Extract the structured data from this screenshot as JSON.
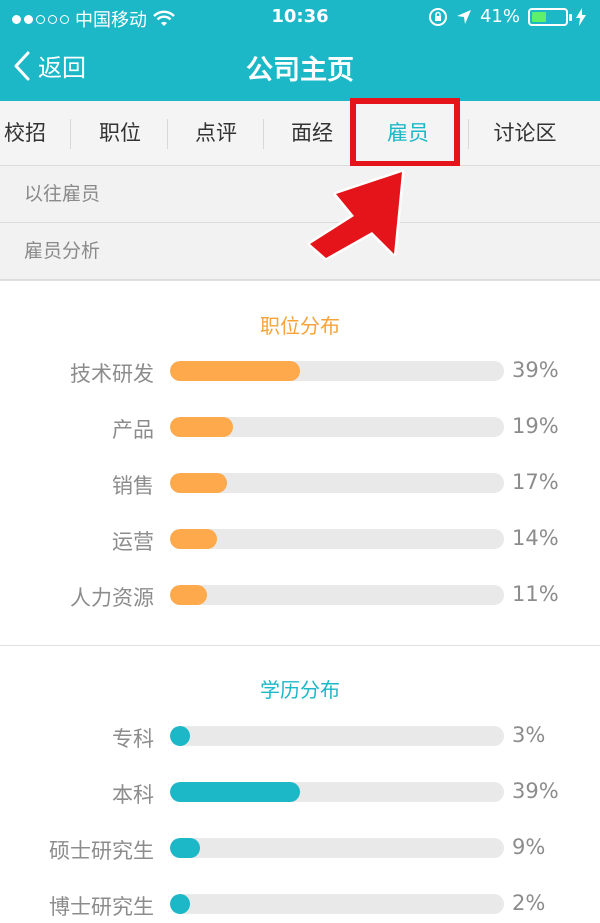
{
  "status_bar": {
    "carrier": "中国移动",
    "time": "10:36",
    "battery": "41%",
    "battery_level": 0.41
  },
  "nav": {
    "back_label": "返回",
    "title": "公司主页"
  },
  "tabs": [
    {
      "label": "校招",
      "active": false
    },
    {
      "label": "职位",
      "active": false
    },
    {
      "label": "点评",
      "active": false
    },
    {
      "label": "面经",
      "active": false
    },
    {
      "label": "雇员",
      "active": true
    },
    {
      "label": "讨论区",
      "active": false
    }
  ],
  "submenu": [
    {
      "label": "以往雇员"
    },
    {
      "label": "雇员分析"
    }
  ],
  "colors": {
    "accent": "#1db8c8",
    "orange": "#ffa94d",
    "highlight": "#e5141a"
  },
  "chart_data": [
    {
      "type": "bar",
      "title": "职位分布",
      "categories": [
        "技术研发",
        "产品",
        "销售",
        "运营",
        "人力资源"
      ],
      "values": [
        39,
        19,
        17,
        14,
        11
      ],
      "value_labels": [
        "39%",
        "19%",
        "17%",
        "14%",
        "11%"
      ],
      "color": "#ffa94d"
    },
    {
      "type": "bar",
      "title": "学历分布",
      "categories": [
        "专科",
        "本科",
        "硕士研究生",
        "博士研究生"
      ],
      "values": [
        3,
        39,
        9,
        2
      ],
      "value_labels": [
        "3%",
        "39%",
        "9%",
        "2%"
      ],
      "color": "#1db8c8"
    }
  ]
}
